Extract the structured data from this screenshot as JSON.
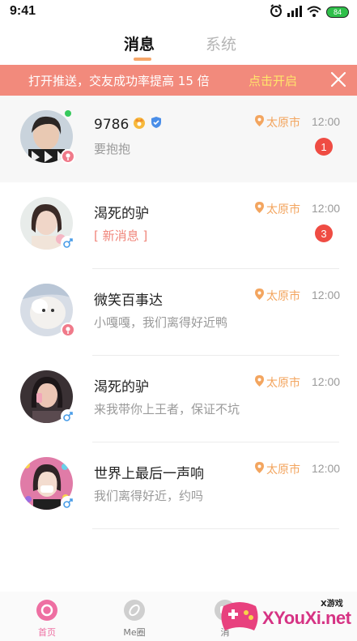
{
  "status_bar": {
    "time": "9:41",
    "battery": "84"
  },
  "tabs": {
    "active": "消息",
    "inactive": "系统"
  },
  "banner": {
    "text": "打开推送，交友成功率提高 15 倍",
    "action": "点击开启"
  },
  "chats": [
    {
      "name": "9786",
      "preview": "要抱抱",
      "location": "太原市",
      "time": "12:00",
      "unread": "1",
      "gender": "female",
      "online": true,
      "badges": [
        "crown-badge-icon",
        "shield-badge-icon"
      ]
    },
    {
      "name": "渴死的驴",
      "preview": "[ 新消息 ]",
      "location": "太原市",
      "time": "12:00",
      "unread": "3",
      "gender": "male",
      "online": false
    },
    {
      "name": "微笑百事达",
      "preview": "小嘎嘎，我们离得好近鸭",
      "location": "太原市",
      "time": "12:00",
      "unread": "",
      "gender": "female",
      "online": false
    },
    {
      "name": "渴死的驴",
      "preview": "来我带你上王者，保证不坑",
      "location": "太原市",
      "time": "12:00",
      "unread": "",
      "gender": "male",
      "online": false
    },
    {
      "name": "世界上最后一声响",
      "preview": "我们离得好近，约吗",
      "location": "太原市",
      "time": "12:00",
      "unread": "",
      "gender": "male",
      "online": false
    }
  ],
  "bottom_nav": {
    "items": [
      {
        "label": "首页",
        "active": true
      },
      {
        "label": "Me圈",
        "active": false
      },
      {
        "label": "消",
        "active": false
      }
    ]
  },
  "watermark": {
    "brand": "XYouXi.net",
    "small": "X游戏"
  },
  "colors": {
    "banner_bg": "#f28a7c",
    "accent_orange": "#f3a55f",
    "unread_red": "#ef4c43",
    "active_pink": "#ee6fa2"
  }
}
